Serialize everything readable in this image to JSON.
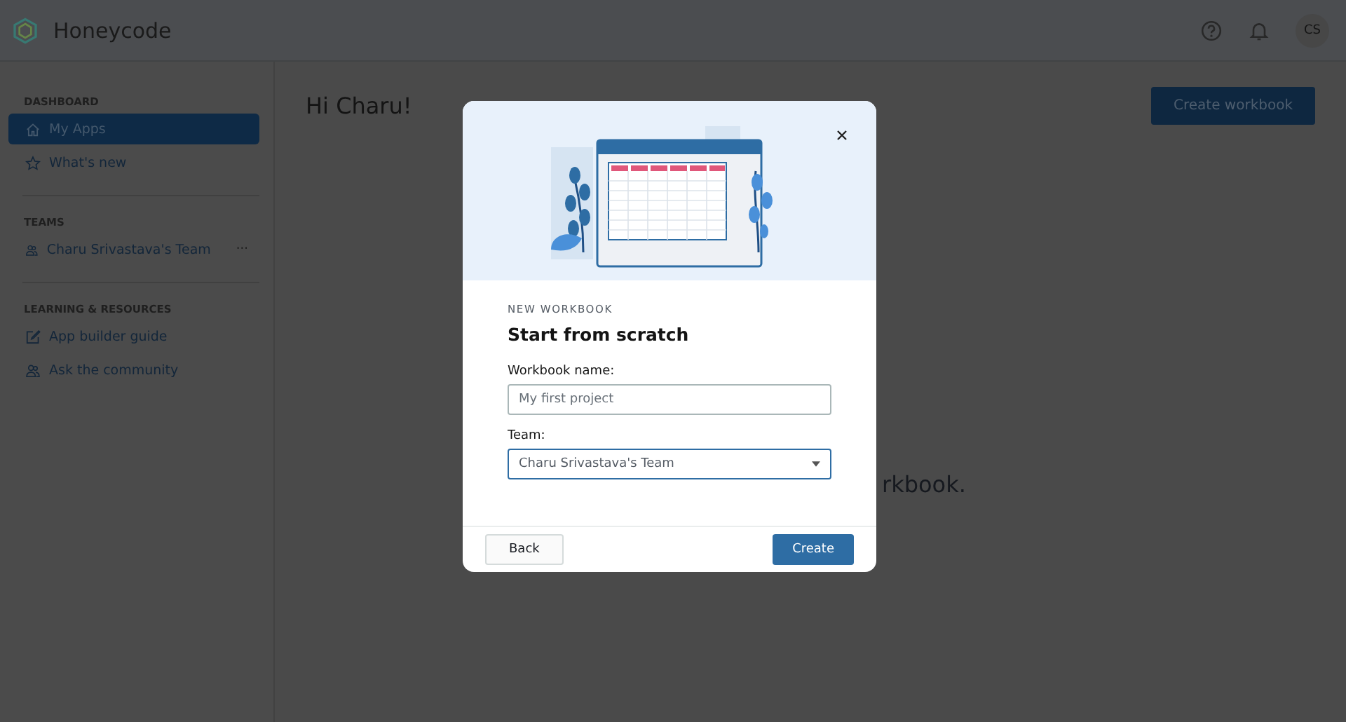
{
  "header": {
    "app_name": "Honeycode",
    "avatar": "CS"
  },
  "sidebar": {
    "sections": [
      {
        "title": "DASHBOARD",
        "items": [
          {
            "label": "My Apps",
            "kind": "home",
            "selected": true
          },
          {
            "label": "What's new",
            "kind": "star",
            "selected": false
          }
        ]
      },
      {
        "title": "TEAMS",
        "items": [
          {
            "label": "Charu Srivastava's Team",
            "kind": "people",
            "selected": false,
            "more": "···"
          }
        ]
      },
      {
        "title": "LEARNING & RESOURCES",
        "items": [
          {
            "label": "App builder guide",
            "kind": "edit",
            "selected": false
          },
          {
            "label": "Ask the community",
            "kind": "people",
            "selected": false
          }
        ]
      }
    ]
  },
  "main": {
    "greeting": "Hi Charu!",
    "create_button": "Create workbook",
    "empty_text": "rkbook."
  },
  "dialog": {
    "eyebrow": "NEW WORKBOOK",
    "title": "Start from scratch",
    "fields": [
      {
        "label": "Workbook name:",
        "kind": "text",
        "placeholder": "My first project",
        "focused": false
      },
      {
        "label": "Team:",
        "kind": "select",
        "value": "Charu Srivastava's Team",
        "focused": true
      }
    ],
    "back": "Back",
    "create": "Create"
  }
}
